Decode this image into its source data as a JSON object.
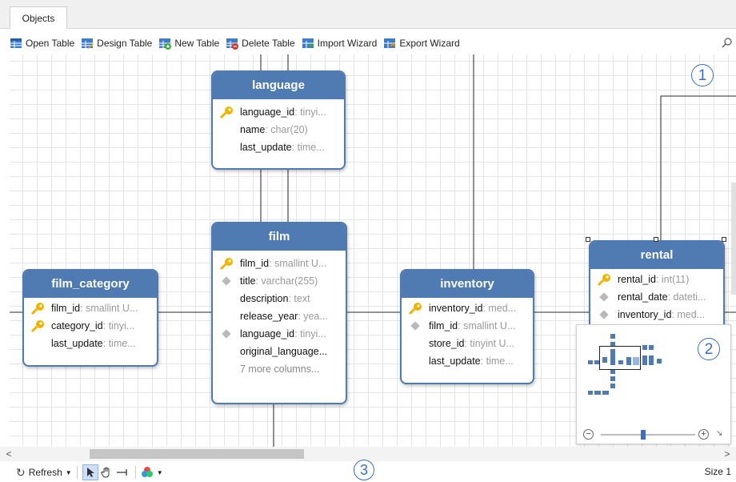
{
  "tabs": [
    {
      "label": "Objects"
    }
  ],
  "toolbar": {
    "open_table": "Open Table",
    "design_table": "Design Table",
    "new_table": "New Table",
    "delete_table": "Delete Table",
    "import_wizard": "Import Wizard",
    "export_wizard": "Export Wizard"
  },
  "tables": {
    "language": {
      "name": "language",
      "columns": [
        {
          "name": "language_id",
          "type": ": tinyi...",
          "key": "primary"
        },
        {
          "name": "name",
          "type": ": char(20)",
          "key": "none"
        },
        {
          "name": "last_update",
          "type": ": time...",
          "key": "none"
        }
      ]
    },
    "film": {
      "name": "film",
      "columns": [
        {
          "name": "film_id",
          "type": ": smallint U...",
          "key": "primary"
        },
        {
          "name": "title",
          "type": ": varchar(255)",
          "key": "index"
        },
        {
          "name": "description",
          "type": ": text",
          "key": "none"
        },
        {
          "name": "release_year",
          "type": ": yea...",
          "key": "none"
        },
        {
          "name": "language_id",
          "type": ": tinyi...",
          "key": "index"
        },
        {
          "name": "original_language...",
          "type": "",
          "key": "none"
        }
      ],
      "more": "7 more columns..."
    },
    "film_category": {
      "name": "film_category",
      "columns": [
        {
          "name": "film_id",
          "type": ": smallint U...",
          "key": "primary"
        },
        {
          "name": "category_id",
          "type": ": tinyi...",
          "key": "primary"
        },
        {
          "name": "last_update",
          "type": ": time...",
          "key": "none"
        }
      ]
    },
    "inventory": {
      "name": "inventory",
      "columns": [
        {
          "name": "inventory_id",
          "type": ": med...",
          "key": "primary"
        },
        {
          "name": "film_id",
          "type": ": smallint U...",
          "key": "index"
        },
        {
          "name": "store_id",
          "type": ": tinyint U...",
          "key": "none"
        },
        {
          "name": "last_update",
          "type": ": time...",
          "key": "none"
        }
      ]
    },
    "rental": {
      "name": "rental",
      "columns": [
        {
          "name": "rental_id",
          "type": ": int(11)",
          "key": "primary"
        },
        {
          "name": "rental_date",
          "type": ": dateti...",
          "key": "index"
        },
        {
          "name": "inventory_id",
          "type": ": med...",
          "key": "index"
        }
      ]
    }
  },
  "callouts": {
    "c1": "1",
    "c2": "2",
    "c3": "3"
  },
  "scroll": {
    "left": "<",
    "right": ">"
  },
  "status": {
    "refresh": "Refresh",
    "size": "Size 1"
  },
  "colors": {
    "table_header": "#4f7ab2",
    "callout": "#3a6fc4",
    "key_icon": "#f0b400"
  },
  "icons": [
    "open-table-icon",
    "design-table-icon",
    "new-table-icon",
    "delete-table-icon",
    "import-wizard-icon",
    "export-wizard-icon",
    "search-icon",
    "key-icon",
    "index-icon",
    "refresh-icon",
    "pointer-icon",
    "hand-icon",
    "connector-icon",
    "color-icon"
  ]
}
